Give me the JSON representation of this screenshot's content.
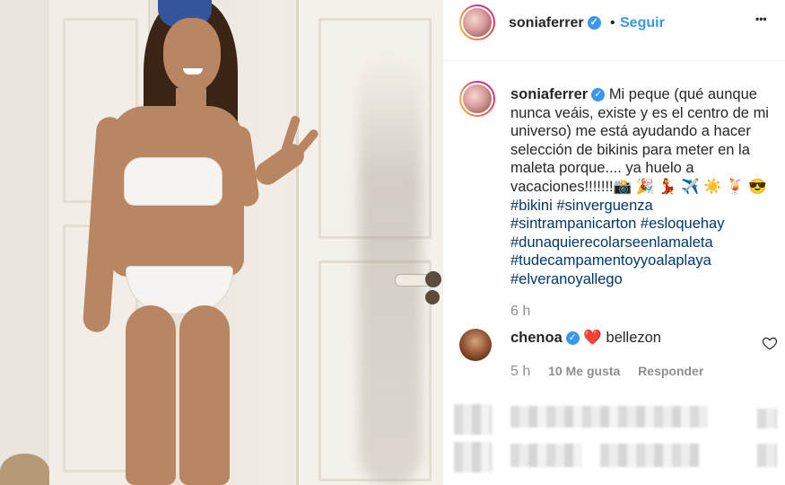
{
  "post": {
    "username": "soniaferrer",
    "follow_label": "Seguir",
    "dot": "•",
    "more_label": "•••"
  },
  "caption": {
    "username": "soniaferrer",
    "text": "Mi peque (qué aunque nunca veáis, existe y es el centro de mi universo) me está ayudando a hacer selección de bikinis para meter en la maleta porque.... ya huelo a vacaciones!!!!!!!📸 🎉 💃 ✈️ ☀️ 🍹 😎",
    "hashtags": [
      "#bikini #sinverguenza",
      "#sintrampanicarton #esloquehay",
      "#dunaquierecolarseenlamaleta",
      "#tudecampamentoyyoalaplaya",
      "#elveranoyallego"
    ],
    "time": "6 h"
  },
  "comment": {
    "username": "chenoa",
    "heart": "❤️",
    "text": "bellezon",
    "time": "5 h",
    "likes": "10 Me gusta",
    "reply_label": "Responder"
  },
  "icons": {
    "verified": "verified-icon",
    "more": "more-options-icon",
    "like": "heart-outline-icon"
  },
  "colors": {
    "link": "#3897f0",
    "hashtag": "#00376b",
    "muted": "#8e8e8e"
  }
}
